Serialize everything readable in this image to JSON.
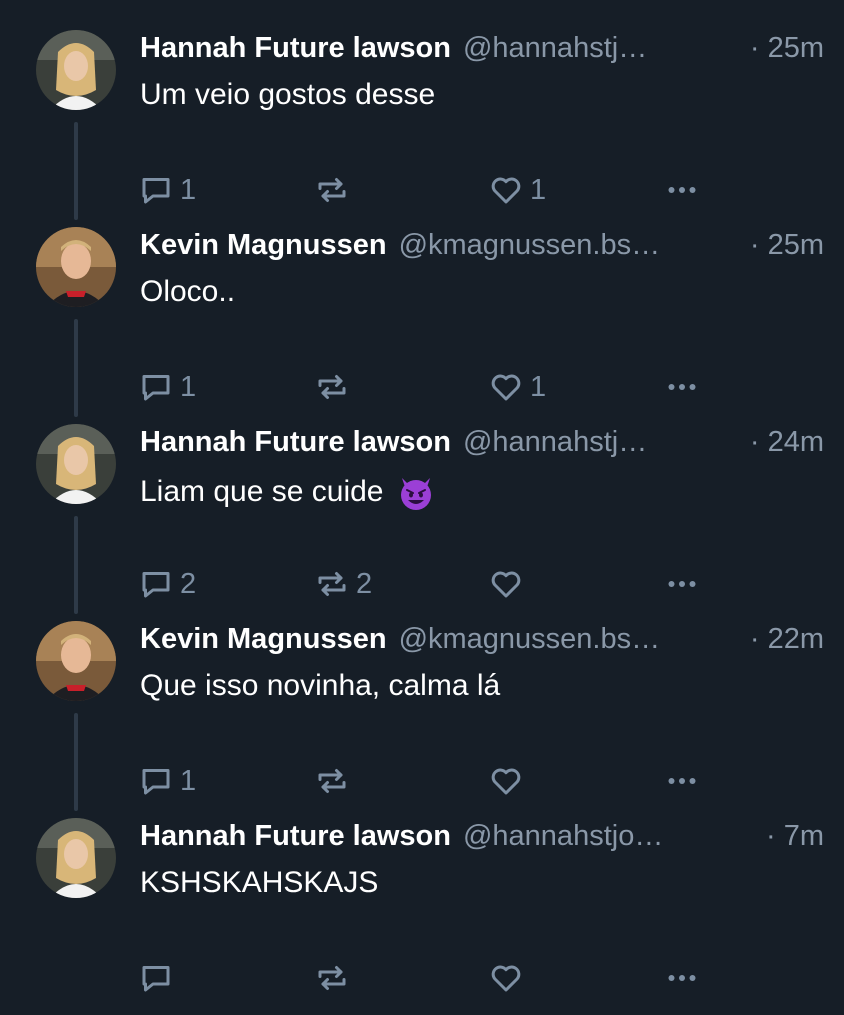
{
  "posts": [
    {
      "author": "Hannah Future lawson",
      "handle": "@hannahstj…",
      "time": "· 25m",
      "text": "Um veio gostos desse",
      "emoji": "",
      "replies": "1",
      "reposts": "",
      "likes": "1",
      "avatar": "hannah"
    },
    {
      "author": "Kevin Magnussen",
      "handle": "@kmagnussen.bs…",
      "time": "· 25m",
      "text": "Oloco..",
      "emoji": "",
      "replies": "1",
      "reposts": "",
      "likes": "1",
      "avatar": "kevin"
    },
    {
      "author": "Hannah Future lawson",
      "handle": "@hannahstj…",
      "time": "· 24m",
      "text": "Liam que se cuide",
      "emoji": "smiling-devil",
      "replies": "2",
      "reposts": "2",
      "likes": "",
      "avatar": "hannah"
    },
    {
      "author": "Kevin Magnussen",
      "handle": "@kmagnussen.bs…",
      "time": "· 22m",
      "text": "Que isso novinha, calma lá",
      "emoji": "",
      "replies": "1",
      "reposts": "",
      "likes": "",
      "avatar": "kevin"
    },
    {
      "author": "Hannah Future lawson",
      "handle": "@hannahstjo…",
      "time": "· 7m",
      "text": "KSHSKAHSKAJS",
      "emoji": "",
      "replies": "",
      "reposts": "",
      "likes": "",
      "avatar": "hannah"
    }
  ],
  "icons": {
    "reply": "reply-icon",
    "repost": "repost-icon",
    "like": "heart-icon",
    "more": "more-icon"
  },
  "colors": {
    "background": "#161e27",
    "muted": "#8a98a8",
    "action": "#7d8fa3",
    "thread_line": "#2e3a48"
  }
}
